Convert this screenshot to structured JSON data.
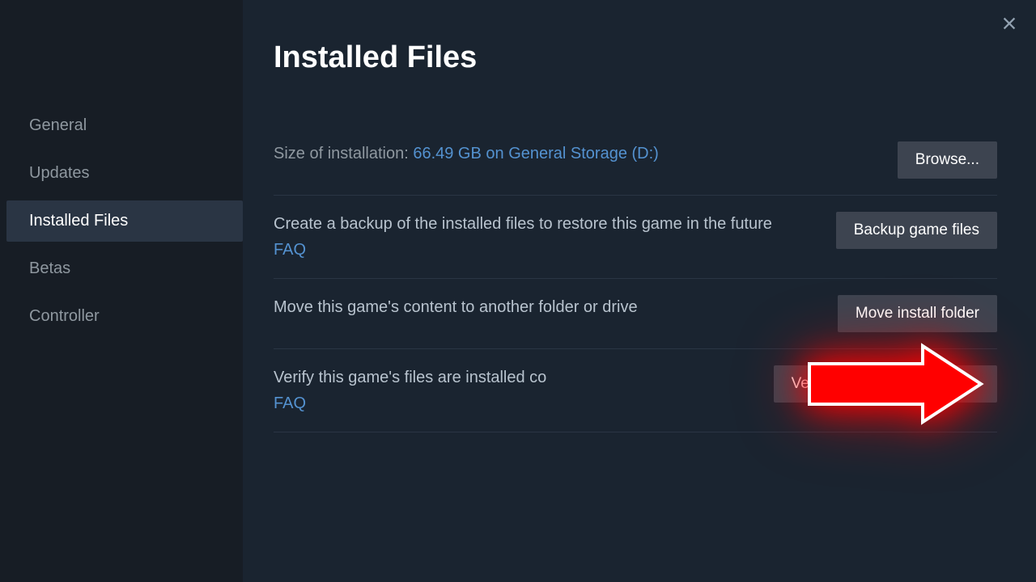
{
  "header": {
    "title": "Installed Files"
  },
  "sidebar": {
    "items": [
      {
        "label": "General"
      },
      {
        "label": "Updates"
      },
      {
        "label": "Installed Files"
      },
      {
        "label": "Betas"
      },
      {
        "label": "Controller"
      }
    ],
    "active_index": 2
  },
  "rows": {
    "size": {
      "prefix": "Size of installation: ",
      "value": "66.49 GB on General Storage (D:)",
      "button": "Browse..."
    },
    "backup": {
      "text": "Create a backup of the installed files to restore this game in the future",
      "faq": "FAQ",
      "button": "Backup game files"
    },
    "move": {
      "text": "Move this game's content to another folder or drive",
      "button": "Move install folder"
    },
    "verify": {
      "text": "Verify this game's files are installed co",
      "faq": "FAQ",
      "button": "Verify integrity of game files"
    }
  }
}
